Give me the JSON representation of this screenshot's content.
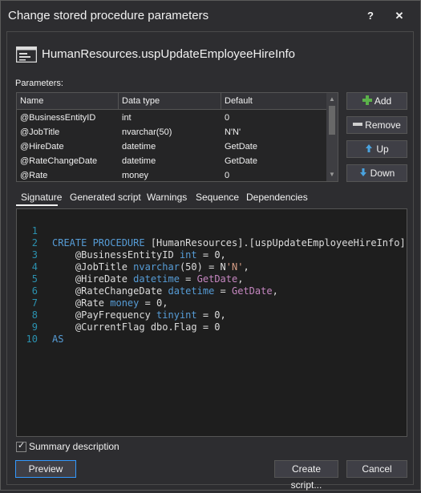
{
  "window": {
    "title": "Change stored procedure parameters",
    "help_label": "?",
    "close_label": "✕"
  },
  "header": {
    "procedure_name": "HumanResources.uspUpdateEmployeeHireInfo",
    "icon": "stored-procedure-icon"
  },
  "parameters": {
    "section_label": "Parameters:",
    "columns": [
      "Name",
      "Data type",
      "Default"
    ],
    "rows": [
      {
        "name": "@BusinessEntityID",
        "type": "int",
        "default": "0"
      },
      {
        "name": "@JobTitle",
        "type": "nvarchar(50)",
        "default": "N'N'"
      },
      {
        "name": "@HireDate",
        "type": "datetime",
        "default": "GetDate"
      },
      {
        "name": "@RateChangeDate",
        "type": "datetime",
        "default": "GetDate"
      },
      {
        "name": "@Rate",
        "type": "money",
        "default": "0"
      }
    ]
  },
  "side_buttons": {
    "add": "Add",
    "remove": "Remove",
    "up": "Up",
    "down": "Down"
  },
  "tabs": [
    "Signature",
    "Generated script",
    "Warnings",
    "Sequence",
    "Dependencies"
  ],
  "active_tab": "Signature",
  "editor": {
    "line_numbers": [
      "1",
      "2",
      "3",
      "4",
      "5",
      "6",
      "7",
      "8",
      "9",
      "10"
    ]
  },
  "summary": {
    "label": "Summary description",
    "checked": true
  },
  "footer": {
    "preview": "Preview",
    "create_script": "Create script...",
    "cancel": "Cancel"
  },
  "colors": {
    "background": "#2d2d30",
    "editor_background": "#1e1e1e",
    "keyword": "#569cd6",
    "function": "#c586c0",
    "string": "#d69d85",
    "line_number": "#2b91af",
    "add_icon": "#5bb14a",
    "arrow_icon": "#4aa3df"
  }
}
